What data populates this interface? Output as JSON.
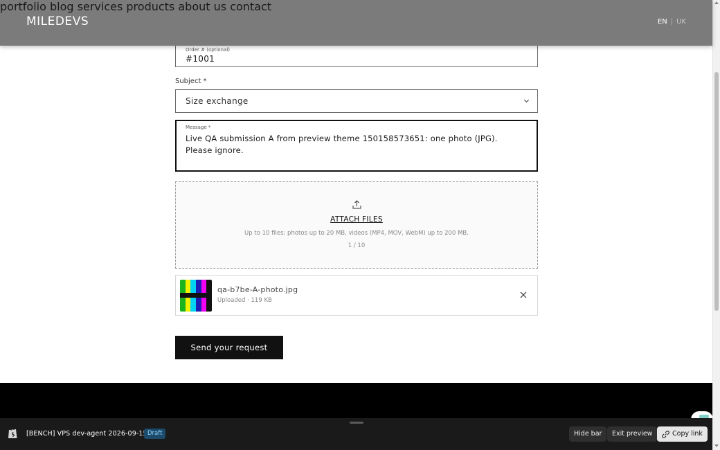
{
  "header": {
    "logo": "MILEDEVS",
    "nav": [
      "portfolio",
      "blog",
      "services",
      "products",
      "about us",
      "contact"
    ],
    "lang_active": "EN",
    "lang_separator": "|",
    "lang_other": "UK"
  },
  "form": {
    "order_label": "Order # (optional)",
    "order_value": "#1001",
    "subject_label": "Subject *",
    "subject_value": "Size exchange",
    "message_label": "Message *",
    "message_value": "Live QA submission A from preview theme 150158573651: one photo (JPG). Please ignore.",
    "attach_label": "ATTACH FILES",
    "attach_limits": "Up to 10 files: photos up to 20 MB, videos (MP4, MOV, WebM) up to 200 MB.",
    "attach_count": "1 / 10",
    "file": {
      "name": "qa-b7be-A-photo.jpg",
      "meta": "Uploaded · 119 KB"
    },
    "submit_label": "Send your request"
  },
  "preview_bar": {
    "title": "[BENCH] VPS dev-agent 2026-09-15",
    "badge": "Draft",
    "hide_bar": "Hide bar",
    "exit_preview": "Exit preview",
    "copy_link": "Copy link"
  },
  "colors": {
    "header_bg": "#7b7b7b",
    "button_bg": "#111111",
    "draft_badge": "#1d4b6b",
    "thumb_bars": [
      "#1db31d",
      "#f2f200",
      "#00d4f2",
      "#1d1db3",
      "#f200f2",
      "#111111"
    ]
  },
  "icons": {
    "upload": "upload-icon",
    "remove": "close-icon",
    "select": "chevron-down-icon",
    "store": "shopify-bag-icon",
    "link": "link-icon"
  }
}
